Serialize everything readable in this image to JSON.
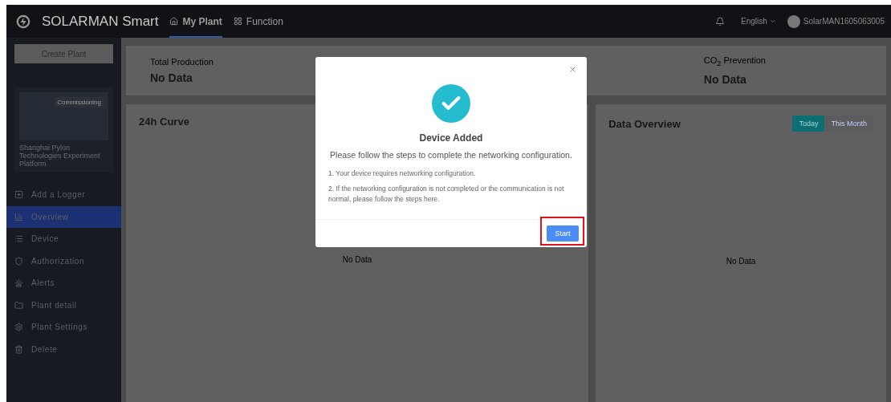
{
  "header": {
    "brand": "SOLARMAN Smart",
    "nav": [
      {
        "label": "My Plant",
        "selected": true
      },
      {
        "label": "Function",
        "selected": false
      }
    ],
    "language": "English",
    "user": "SolarMAN1605063005"
  },
  "sidebar": {
    "create_button": "Create Plant",
    "plant": {
      "status": "Commissioning",
      "name": "Shanghai Pylon Technologies Experiment Platform"
    },
    "items": [
      {
        "label": "Add a Logger",
        "selected": false
      },
      {
        "label": "Overview",
        "selected": true
      },
      {
        "label": "Device",
        "selected": false
      },
      {
        "label": "Authorization",
        "selected": false
      },
      {
        "label": "Alerts",
        "selected": false
      },
      {
        "label": "Plant detail",
        "selected": false
      },
      {
        "label": "Plant Settings",
        "selected": false
      },
      {
        "label": "Delete",
        "selected": false
      }
    ]
  },
  "stats": [
    {
      "label": "Total Production",
      "value": "No Data"
    },
    {
      "label": "CO$_{2}$ Prevention",
      "value": "No Data"
    }
  ],
  "panels": [
    {
      "title": "24h Curve",
      "empty": "No Data"
    },
    {
      "title": "Data Overview",
      "empty": "No Data",
      "tabs": [
        {
          "label": "Today",
          "selected": true
        },
        {
          "label": "This Month",
          "selected": false
        }
      ]
    }
  ],
  "dialog": {
    "title": "Device Added",
    "subtitle": "Please follow the steps to complete the networking configuration.",
    "steps": [
      "1. Your device requires networking configuration.",
      "2. If the networking configuration is not completed or the communication is not normal, please follow the steps here."
    ],
    "button": "Start",
    "button_highlighted": true
  }
}
